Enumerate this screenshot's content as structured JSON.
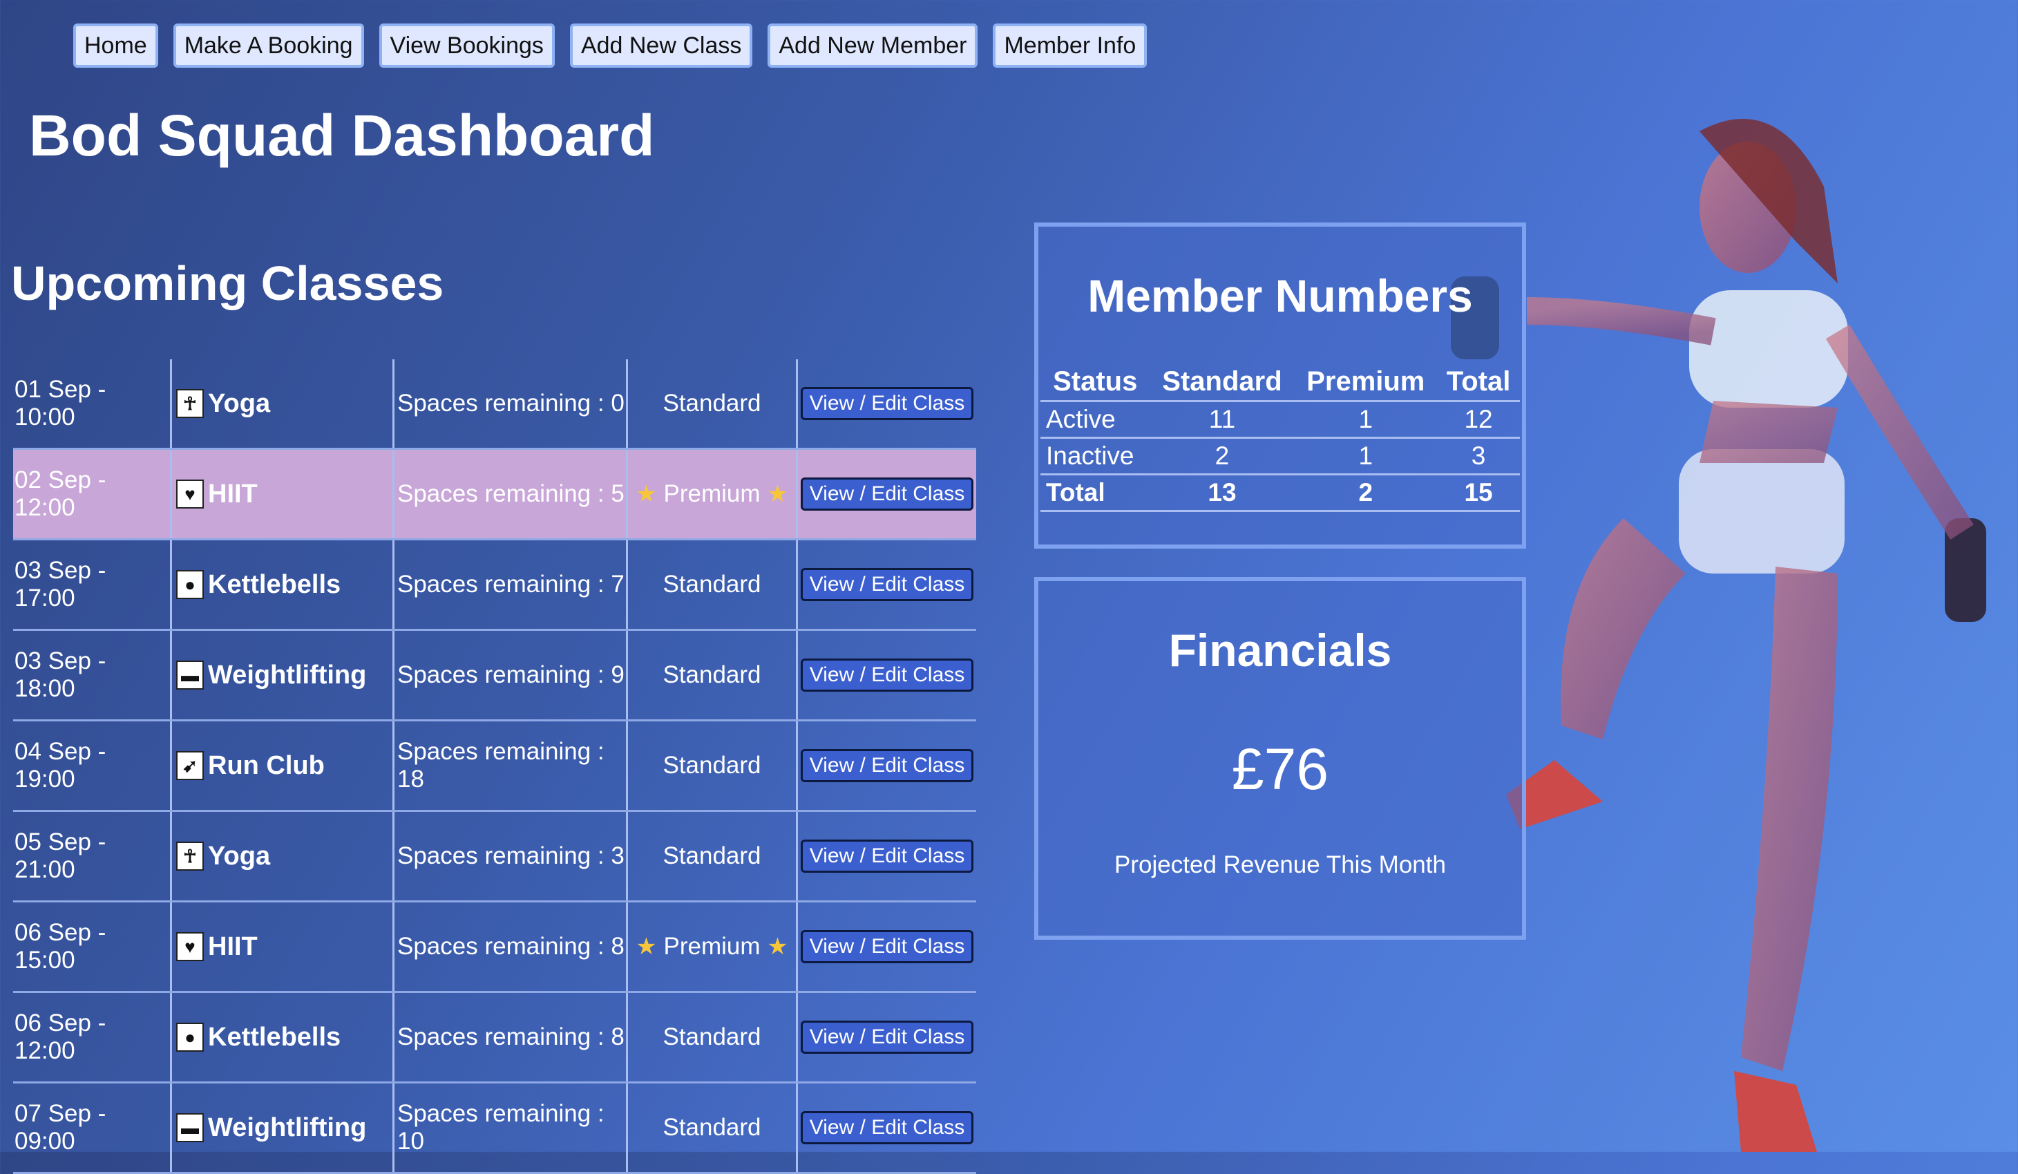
{
  "nav": [
    "Home",
    "Make A Booking",
    "View Bookings",
    "Add New Class",
    "Add New Member",
    "Member Info"
  ],
  "title": "Bod Squad Dashboard",
  "upcoming": {
    "heading": "Upcoming Classes",
    "rows": [
      {
        "date": "01 Sep - 10:00",
        "name": "Yoga",
        "icon": "yoga-icon",
        "glyph": "☥",
        "spaces": "Spaces remaining : 0",
        "tier": "Standard",
        "premium": false,
        "action": "View / Edit Class"
      },
      {
        "date": "02 Sep - 12:00",
        "name": "HIIT",
        "icon": "heart-hands-icon",
        "glyph": "♥",
        "spaces": "Spaces remaining : 5",
        "tier": "Premium",
        "premium": true,
        "action": "View / Edit Class"
      },
      {
        "date": "03 Sep - 17:00",
        "name": "Kettlebells",
        "icon": "kettlebell-icon",
        "glyph": "●",
        "spaces": "Spaces remaining : 7",
        "tier": "Standard",
        "premium": false,
        "action": "View / Edit Class"
      },
      {
        "date": "03 Sep - 18:00",
        "name": "Weightlifting",
        "icon": "barbell-icon",
        "glyph": "▬",
        "spaces": "Spaces remaining : 9",
        "tier": "Standard",
        "premium": false,
        "action": "View / Edit Class"
      },
      {
        "date": "04 Sep - 19:00",
        "name": "Run Club",
        "icon": "runner-icon",
        "glyph": "➹",
        "spaces": "Spaces remaining : 18",
        "tier": "Standard",
        "premium": false,
        "action": "View / Edit Class"
      },
      {
        "date": "05 Sep - 21:00",
        "name": "Yoga",
        "icon": "yoga-icon",
        "glyph": "☥",
        "spaces": "Spaces remaining : 3",
        "tier": "Standard",
        "premium": false,
        "action": "View / Edit Class"
      },
      {
        "date": "06 Sep - 15:00",
        "name": "HIIT",
        "icon": "heart-hands-icon",
        "glyph": "♥",
        "spaces": "Spaces remaining : 8",
        "tier": "Premium",
        "premium": false,
        "action": "View / Edit Class"
      },
      {
        "date": "06 Sep - 12:00",
        "name": "Kettlebells",
        "icon": "kettlebell-icon",
        "glyph": "●",
        "spaces": "Spaces remaining : 8",
        "tier": "Standard",
        "premium": false,
        "action": "View / Edit Class"
      },
      {
        "date": "07 Sep - 09:00",
        "name": "Weightlifting",
        "icon": "barbell-icon",
        "glyph": "▬",
        "spaces": "Spaces remaining : 10",
        "tier": "Standard",
        "premium": false,
        "action": "View / Edit Class"
      }
    ]
  },
  "members": {
    "heading": "Member Numbers",
    "columns": [
      "Status",
      "Standard",
      "Premium",
      "Total"
    ],
    "rows": [
      [
        "Active",
        "11",
        "1",
        "12"
      ],
      [
        "Inactive",
        "2",
        "1",
        "3"
      ],
      [
        "Total",
        "13",
        "2",
        "15"
      ]
    ]
  },
  "financials": {
    "heading": "Financials",
    "amount": "£76",
    "caption": "Projected Revenue This Month"
  },
  "colors": {
    "premium_row": "#c8a6d8",
    "panel_border": "#7fa2f0",
    "button": "#3b5fcf"
  }
}
